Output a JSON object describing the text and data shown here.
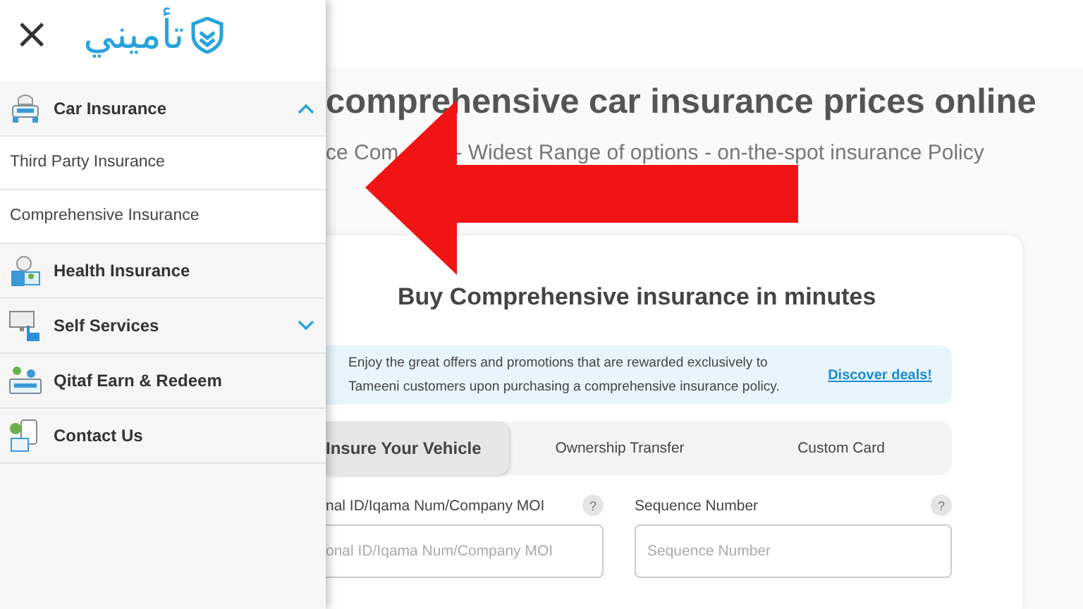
{
  "drawer": {
    "close": "×",
    "logo": "تأميني",
    "menu": [
      {
        "label": "Car Insurance",
        "kind": "section",
        "expanded": true,
        "children": [
          {
            "label": "Third Party Insurance"
          },
          {
            "label": "Comprehensive Insurance"
          }
        ]
      },
      {
        "label": "Health Insurance",
        "kind": "link"
      },
      {
        "label": "Self Services",
        "kind": "section",
        "expanded": false
      },
      {
        "label": "Qitaf Earn & Redeem",
        "kind": "link"
      },
      {
        "label": "Contact Us",
        "kind": "link"
      }
    ]
  },
  "page": {
    "headline": "comprehensive car insurance prices online",
    "subtitle": [
      "ce Com",
      "- Widest Range of options - on-the-spot insurance Policy"
    ],
    "card": {
      "title": "Buy Comprehensive insurance in minutes",
      "promo": {
        "text": "Enjoy the great offers and promotions that are rewarded exclusively to Tameeni customers upon purchasing a comprehensive insurance policy.",
        "link": "Discover deals!"
      },
      "tabs": [
        {
          "label": "Insure Your Vehicle",
          "selected": true
        },
        {
          "label": "Ownership Transfer",
          "selected": false
        },
        {
          "label": "Custom Card",
          "selected": false
        }
      ],
      "fields": [
        {
          "label": "nal ID/Iqama Num/Company MOI",
          "help": "?",
          "placeholder": "onal ID/Iqama Num/Company MOI"
        },
        {
          "label": "Sequence Number",
          "help": "?",
          "placeholder": "Sequence Number"
        }
      ]
    }
  }
}
